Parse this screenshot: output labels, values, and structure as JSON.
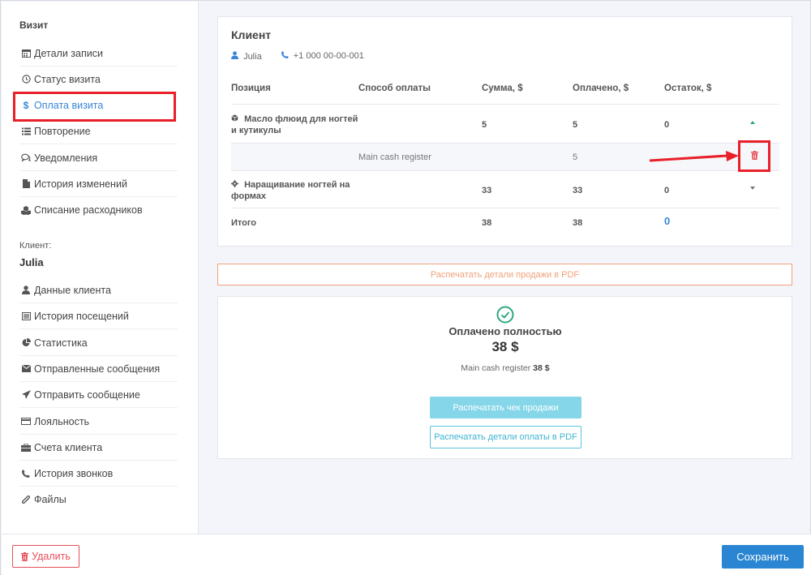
{
  "sidebar": {
    "visit_section": "Визит",
    "visit_items": [
      {
        "label": "Детали записи",
        "icon": "calendar-icon"
      },
      {
        "label": "Статус визита",
        "icon": "clock-icon"
      },
      {
        "label": "Оплата визита",
        "icon": "dollar-icon"
      },
      {
        "label": "Повторение",
        "icon": "list-icon"
      },
      {
        "label": "Уведомления",
        "icon": "chat-icon"
      },
      {
        "label": "История изменений",
        "icon": "file-icon"
      },
      {
        "label": "Списание расходников",
        "icon": "cubes-icon"
      }
    ],
    "client_label": "Клиент:",
    "client_name": "Julia",
    "client_items": [
      {
        "label": "Данные клиента",
        "icon": "user-icon"
      },
      {
        "label": "История посещений",
        "icon": "history-icon"
      },
      {
        "label": "Статистика",
        "icon": "pie-chart-icon"
      },
      {
        "label": "Отправленные сообщения",
        "icon": "envelope-icon"
      },
      {
        "label": "Отправить сообщение",
        "icon": "paper-plane-icon"
      },
      {
        "label": "Лояльность",
        "icon": "card-icon"
      },
      {
        "label": "Счета клиента",
        "icon": "briefcase-icon"
      },
      {
        "label": "История звонков",
        "icon": "phone-icon"
      },
      {
        "label": "Файлы",
        "icon": "paperclip-icon"
      }
    ]
  },
  "client_card": {
    "title": "Клиент",
    "name": "Julia",
    "phone": "+1 000 00-00-001"
  },
  "table": {
    "headers": [
      "Позиция",
      "Способ оплаты",
      "Сумма, $",
      "Оплачено, $",
      "Остаток, $"
    ],
    "rows": [
      {
        "position_line1": "Масло флюид для ногтей",
        "position_line2": "и кутикулы",
        "sum": "5",
        "paid": "5",
        "rest": "0"
      },
      {
        "method": "Main cash register",
        "paid": "5"
      },
      {
        "position_line1": "Наращивание ногтей на",
        "position_line2": "формах",
        "sum": "33",
        "paid": "33",
        "rest": "0"
      }
    ],
    "total_label": "Итого",
    "total_sum": "38",
    "total_paid": "38",
    "total_rest": "0"
  },
  "print_sale_pdf": "Распечатать детали продажи в PDF",
  "payment": {
    "status": "Оплачено полностью",
    "amount": "38 $",
    "register_label": "Main cash register",
    "register_amount": "38 $",
    "print_receipt": "Распечатать чек продажи",
    "print_payment_pdf": "Распечатать детали оплаты в PDF"
  },
  "footer": {
    "delete_label": "Удалить",
    "save_label": "Сохранить"
  },
  "colors": {
    "accent": "#2a86d2",
    "highlight": "#e8202a",
    "success": "#2fa87c",
    "orange": "#f0a27a"
  }
}
